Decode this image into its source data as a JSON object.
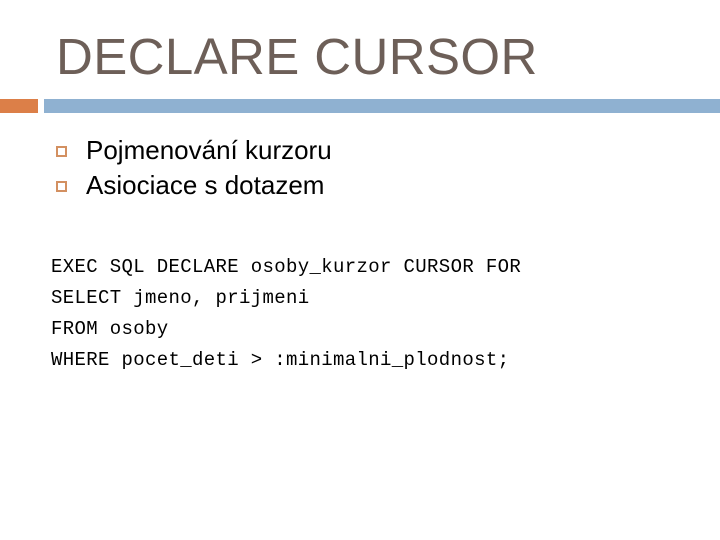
{
  "slide": {
    "title": "DECLARE CURSOR",
    "colors": {
      "title_text": "#6d5f58",
      "accent_orange": "#dc7f48",
      "divider_blue": "#8fb1d1",
      "bullet_marker": "#d39061",
      "body_text": "#000000",
      "background": "#ffffff"
    },
    "bullets": [
      {
        "marker": "hollow-square-bullet",
        "text": "Pojmenování kurzoru"
      },
      {
        "marker": "hollow-square-bullet",
        "text": "Asiociace s dotazem"
      }
    ],
    "code": {
      "language": "sql",
      "lines": [
        "EXEC SQL DECLARE osoby_kurzor CURSOR FOR",
        "SELECT jmeno, prijmeni",
        "FROM osoby",
        "WHERE pocet_deti > :minimalni_plodnost;"
      ]
    }
  }
}
